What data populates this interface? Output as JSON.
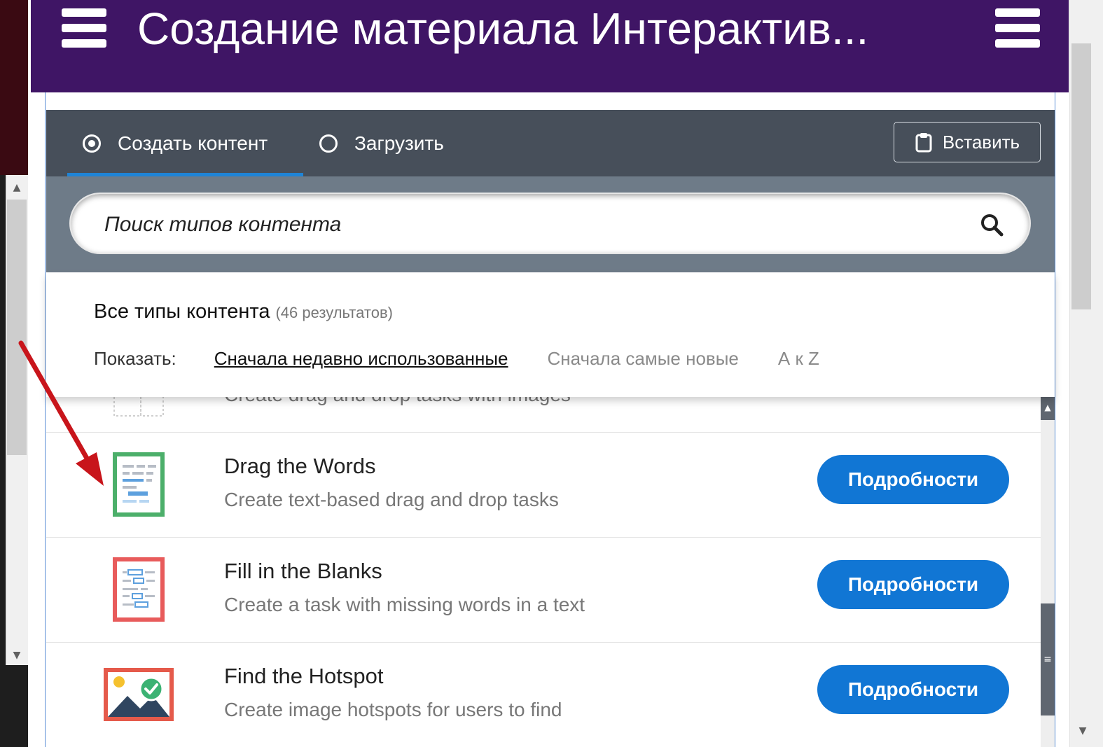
{
  "header": {
    "title": "Создание материала Интерактив..."
  },
  "tabs": {
    "create_label": "Создать контент",
    "upload_label": "Загрузить",
    "paste_label": "Вставить"
  },
  "search": {
    "placeholder": "Поиск типов контента"
  },
  "results": {
    "title": "Все типы контента",
    "count": "(46 результатов)",
    "show_label": "Показать:",
    "sort_recent": "Сначала недавно использованные",
    "sort_newest": "Сначала самые новые",
    "sort_az": "А к Z"
  },
  "items": [
    {
      "title": "",
      "description": "Create drag and drop tasks with images",
      "button": "",
      "icon": "drag-and-drop-icon"
    },
    {
      "title": "Drag the Words",
      "description": "Create text-based drag and drop tasks",
      "button": "Подробности",
      "icon": "drag-the-words-icon"
    },
    {
      "title": "Fill in the Blanks",
      "description": "Create a task with missing words in a text",
      "button": "Подробности",
      "icon": "fill-in-the-blanks-icon"
    },
    {
      "title": "Find the Hotspot",
      "description": "Create image hotspots for users to find",
      "button": "Подробности",
      "icon": "find-the-hotspot-icon"
    }
  ],
  "colors": {
    "header_bg": "#3f1565",
    "tabbar_bg": "#474f5a",
    "search_bg": "#6e7b88",
    "button_blue": "#1176d4",
    "annotation_red": "#c8151b"
  }
}
